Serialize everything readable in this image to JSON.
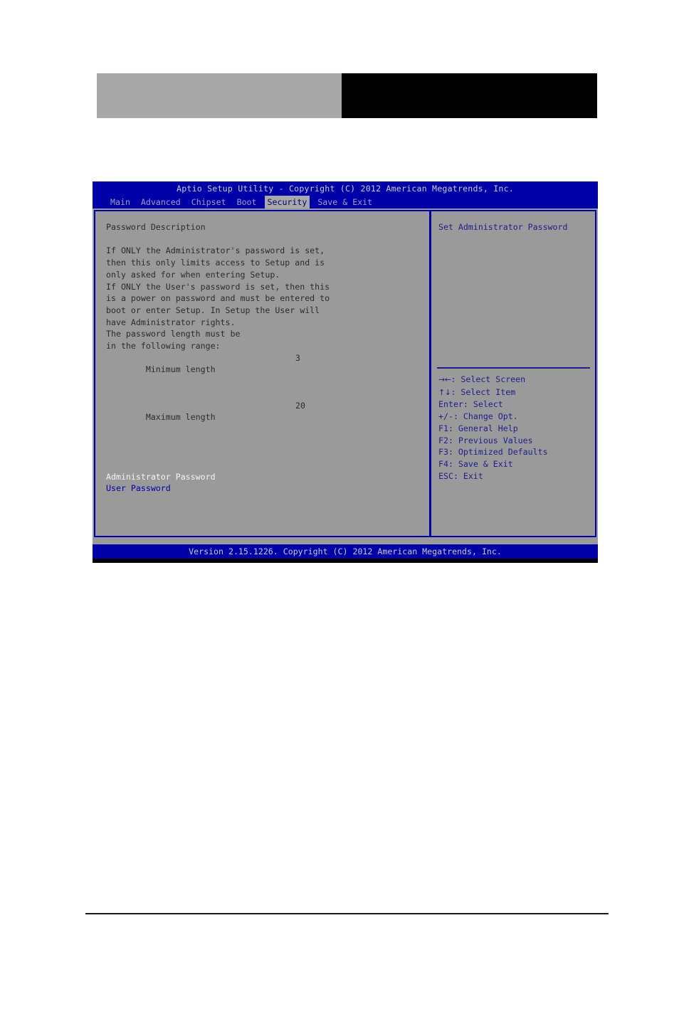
{
  "document_header": {
    "left_block_color": "#a8a8a8",
    "right_block_color": "#000000"
  },
  "bios": {
    "title": "Aptio Setup Utility - Copyright (C) 2012 American Megatrends, Inc.",
    "footer": "Version 2.15.1226. Copyright (C) 2012 American Megatrends, Inc.",
    "colors": {
      "bar_background": "#0000a8",
      "content_background": "#9a9a9a",
      "accent_text": "#20208c",
      "selected_text": "#f4f4f4",
      "active_tab_background": "#a8a8a8"
    },
    "menu": {
      "tabs": [
        {
          "label": "Main",
          "active": false
        },
        {
          "label": "Advanced",
          "active": false
        },
        {
          "label": "Chipset",
          "active": false
        },
        {
          "label": "Boot",
          "active": false
        },
        {
          "label": "Security",
          "active": true
        },
        {
          "label": "Save & Exit",
          "active": false
        }
      ]
    },
    "settings": {
      "section_title": "Password Description",
      "description_lines": [
        "If ONLY the Administrator's password is set,",
        "then this only limits access to Setup and is",
        "only asked for when entering Setup.",
        "If ONLY the User's password is set, then this",
        "is a power on password and must be entered to",
        "boot or enter Setup. In Setup the User will",
        "have Administrator rights.",
        "The password length must be",
        "in the following range:"
      ],
      "length_rows": [
        {
          "label": "Minimum length",
          "value": "3"
        },
        {
          "label": "Maximum length",
          "value": "20"
        }
      ],
      "password_items": [
        {
          "label": "Administrator Password",
          "selected": true
        },
        {
          "label": "User Password",
          "selected": false
        }
      ]
    },
    "help": {
      "description": "Set Administrator Password",
      "legend": [
        {
          "glyph": "→←",
          "text": ": Select Screen"
        },
        {
          "glyph": "↑↓",
          "text": ": Select Item"
        },
        {
          "glyph": "",
          "text": "Enter: Select"
        },
        {
          "glyph": "",
          "text": "+/-: Change Opt."
        },
        {
          "glyph": "",
          "text": "F1: General Help"
        },
        {
          "glyph": "",
          "text": "F2: Previous Values"
        },
        {
          "glyph": "",
          "text": "F3: Optimized Defaults"
        },
        {
          "glyph": "",
          "text": "F4: Save & Exit"
        },
        {
          "glyph": "",
          "text": "ESC: Exit"
        }
      ]
    }
  }
}
